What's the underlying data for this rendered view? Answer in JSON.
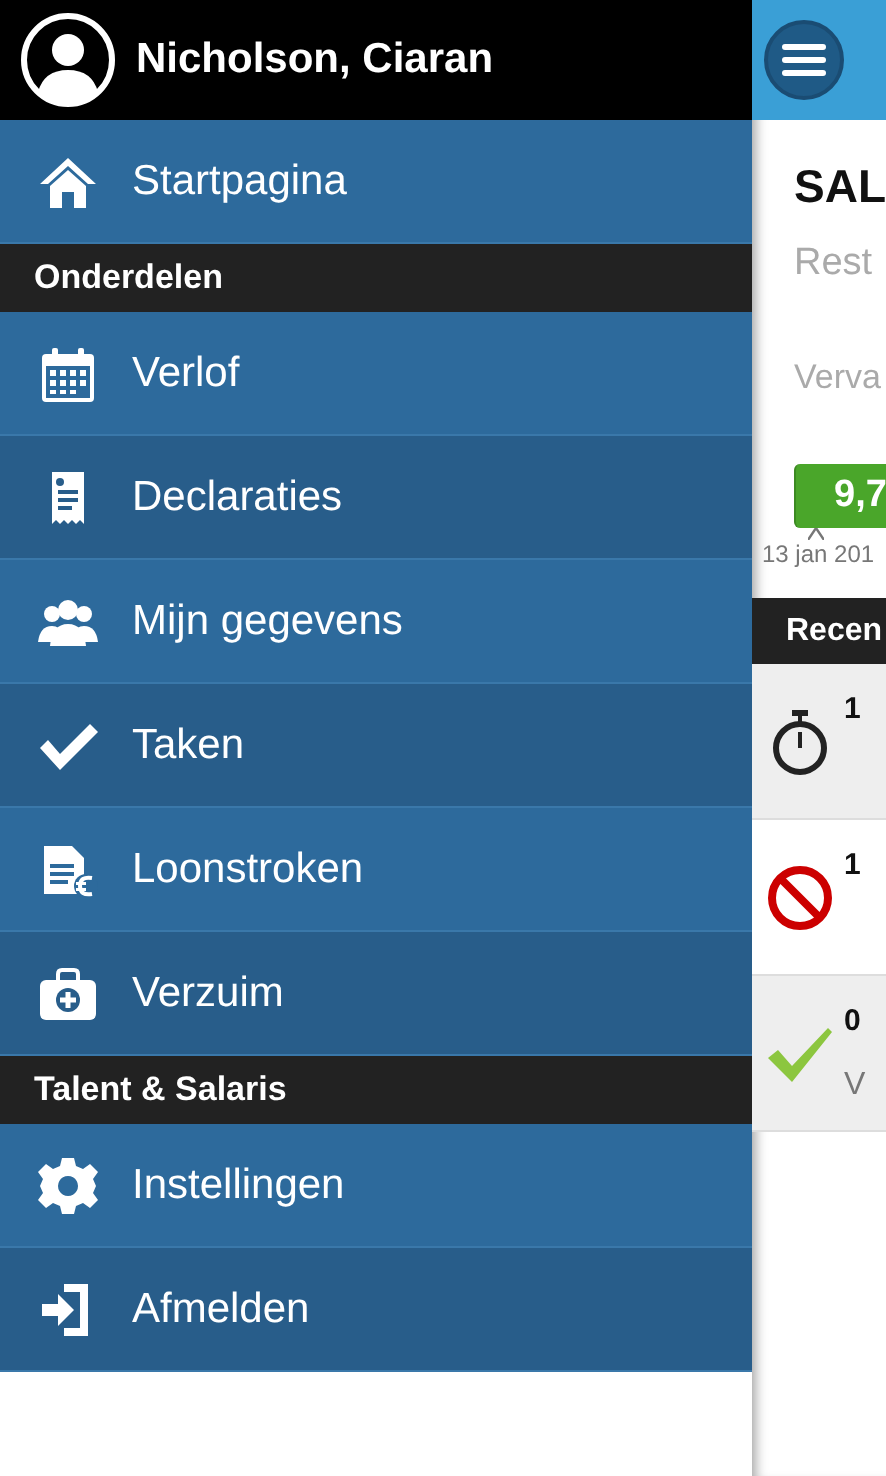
{
  "user": {
    "name": "Nicholson, Ciaran"
  },
  "menu": [
    {
      "kind": "item",
      "label": "Startpagina"
    },
    {
      "kind": "section",
      "label": "Onderdelen"
    },
    {
      "kind": "item",
      "label": "Verlof"
    },
    {
      "kind": "item",
      "label": "Declaraties"
    },
    {
      "kind": "item",
      "label": "Mijn gegevens"
    },
    {
      "kind": "item",
      "label": "Taken"
    },
    {
      "kind": "item",
      "label": "Loonstroken"
    },
    {
      "kind": "item",
      "label": "Verzuim"
    },
    {
      "kind": "section",
      "label": "Talent & Salaris"
    },
    {
      "kind": "item",
      "label": "Instellingen"
    },
    {
      "kind": "item",
      "label": "Afmelden"
    }
  ],
  "main": {
    "title": "SAL",
    "lines": [
      "Rest",
      "Verva"
    ],
    "balance": {
      "value": "9,7",
      "date": "13 jan 201"
    },
    "recent": {
      "title": "Recen",
      "rows": [
        {
          "kind": "timer",
          "title": "1"
        },
        {
          "kind": "blocked",
          "title": "1"
        },
        {
          "kind": "done",
          "title": "0",
          "subtitle": "V"
        }
      ]
    }
  }
}
